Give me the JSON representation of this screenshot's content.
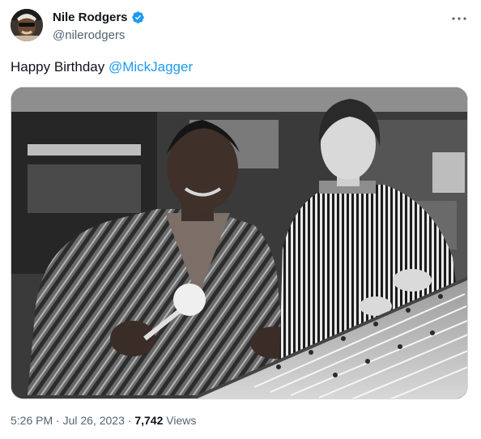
{
  "author": {
    "display_name": "Nile Rodgers",
    "handle": "@nilerodgers",
    "verified": true,
    "verified_color": "#1d9bf0",
    "avatar": "profile-photo"
  },
  "menu": {
    "more_icon": "more-horizontal-icon",
    "glyph": "···"
  },
  "tweet": {
    "text_prefix": "Happy Birthday ",
    "mention": "@MickJagger",
    "mention_color": "#1d9bf0"
  },
  "media": {
    "description_icon": "photo",
    "alt": "Black and white photo of two men seated at a recording studio mixing console"
  },
  "meta": {
    "time": "5:26 PM",
    "separator1": " · ",
    "date": "Jul 26, 2023",
    "separator2": " · ",
    "views_count": "7,742",
    "views_label": " Views"
  }
}
